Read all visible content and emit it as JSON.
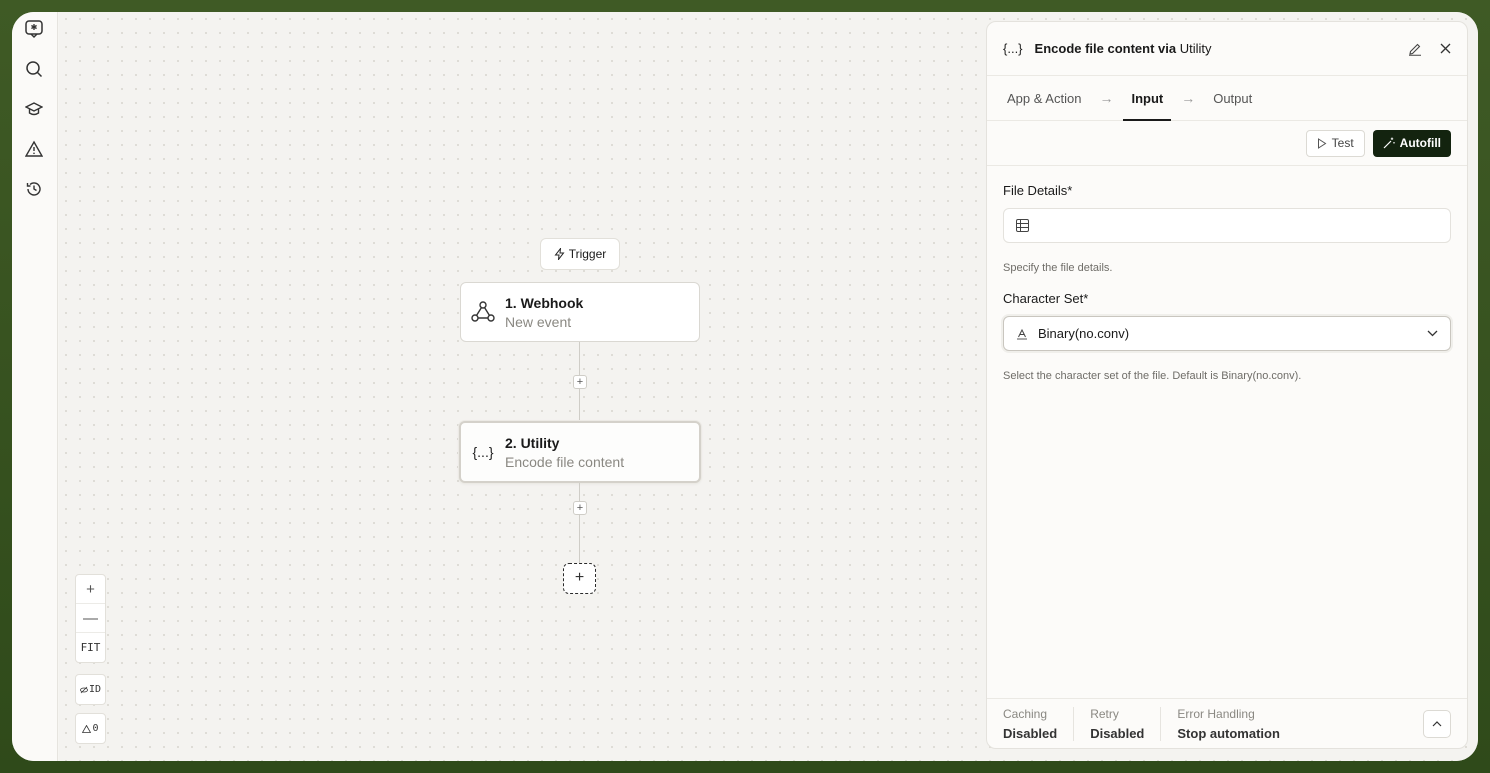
{
  "canvas": {
    "trigger_label": "Trigger",
    "nodes": [
      {
        "title": "1. Webhook",
        "subtitle": "New event"
      },
      {
        "title": "2. Utility",
        "subtitle": "Encode file content"
      }
    ],
    "node_icon_text": "{...}",
    "add_step_symbol": "+",
    "zoom": {
      "in": "+",
      "out": "—",
      "fit": "FIT"
    },
    "id_toggle_label": "ID",
    "warnings_count": "0"
  },
  "panel": {
    "header": {
      "icon_text": "{...}",
      "title_action": "Encode file content via",
      "title_app": "Utility"
    },
    "tabs": [
      {
        "label": "App & Action",
        "active": false
      },
      {
        "label": "Input",
        "active": true
      },
      {
        "label": "Output",
        "active": false
      }
    ],
    "tab_separator": "→",
    "actions": {
      "test_label": "Test",
      "autofill_label": "Autofill"
    },
    "fields": {
      "file_details": {
        "label": "File Details*",
        "value": "",
        "help": "Specify the file details."
      },
      "character_set": {
        "label": "Character Set*",
        "value": "Binary(no.conv)",
        "help": "Select the character set of the file. Default is Binary(no.conv)."
      }
    },
    "footer": {
      "caching": {
        "label": "Caching",
        "value": "Disabled"
      },
      "retry": {
        "label": "Retry",
        "value": "Disabled"
      },
      "error_handling": {
        "label": "Error Handling",
        "value": "Stop automation"
      }
    }
  },
  "colors": {
    "autofill_bg": "#13230f",
    "background_outer": "#3f5a25"
  }
}
